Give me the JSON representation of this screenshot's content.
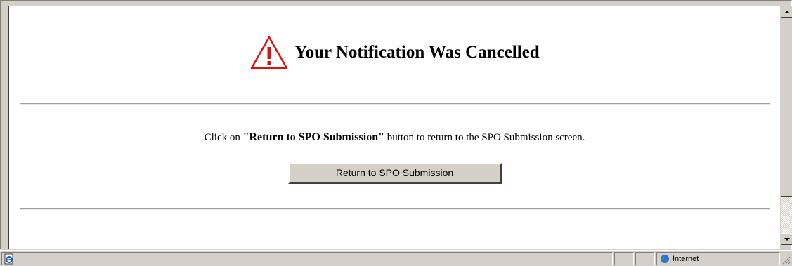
{
  "page": {
    "title": "Your Notification Was Cancelled",
    "message_prefix": "Click on ",
    "message_emphasis": "\"Return to SPO Submission\"",
    "message_suffix": " button to return to the SPO Submission screen.",
    "button_label": "Return to SPO Submission"
  },
  "status_bar": {
    "zone_label": "Internet"
  },
  "icons": {
    "title_icon": "warning-triangle-icon",
    "status_left": "ie-page-icon",
    "zone_icon": "globe-icon"
  },
  "colors": {
    "warning": "#e01010",
    "chrome": "#d4d0c8"
  }
}
